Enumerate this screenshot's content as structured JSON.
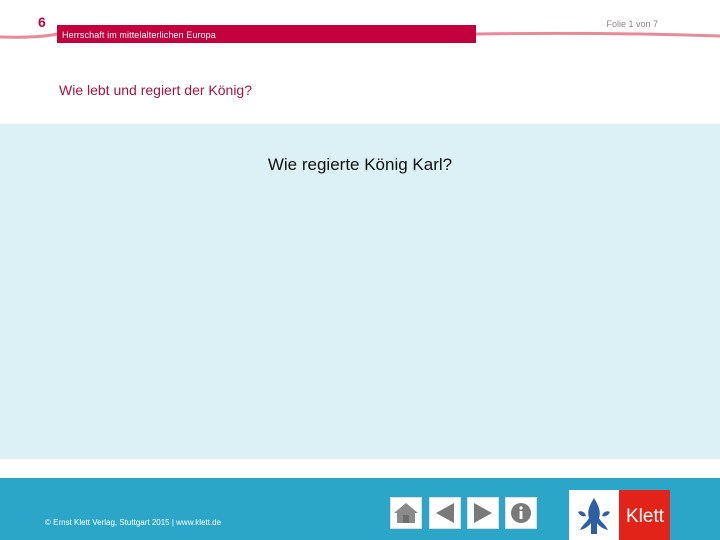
{
  "header": {
    "chapter_number": "6",
    "chapter_title": "Herrschaft im mittelalterlichen Europa",
    "slide_counter": "Folie 1 von 7",
    "accent_color": "#c4003f"
  },
  "subtitle": "Wie lebt und regiert der König?",
  "main": {
    "question": "Wie regierte König Karl?",
    "panel_color": "#dcf1f5"
  },
  "footer": {
    "copyright": "© Ernst Klett Verlag, Stuttgart 2015 | www.klett.de",
    "background_color": "#2ba6c8",
    "nav_buttons": [
      {
        "icon": "home-icon"
      },
      {
        "icon": "previous-icon"
      },
      {
        "icon": "next-icon"
      },
      {
        "icon": "info-icon"
      }
    ],
    "logo_text": "Klett",
    "logo_color": "#e2231a"
  }
}
